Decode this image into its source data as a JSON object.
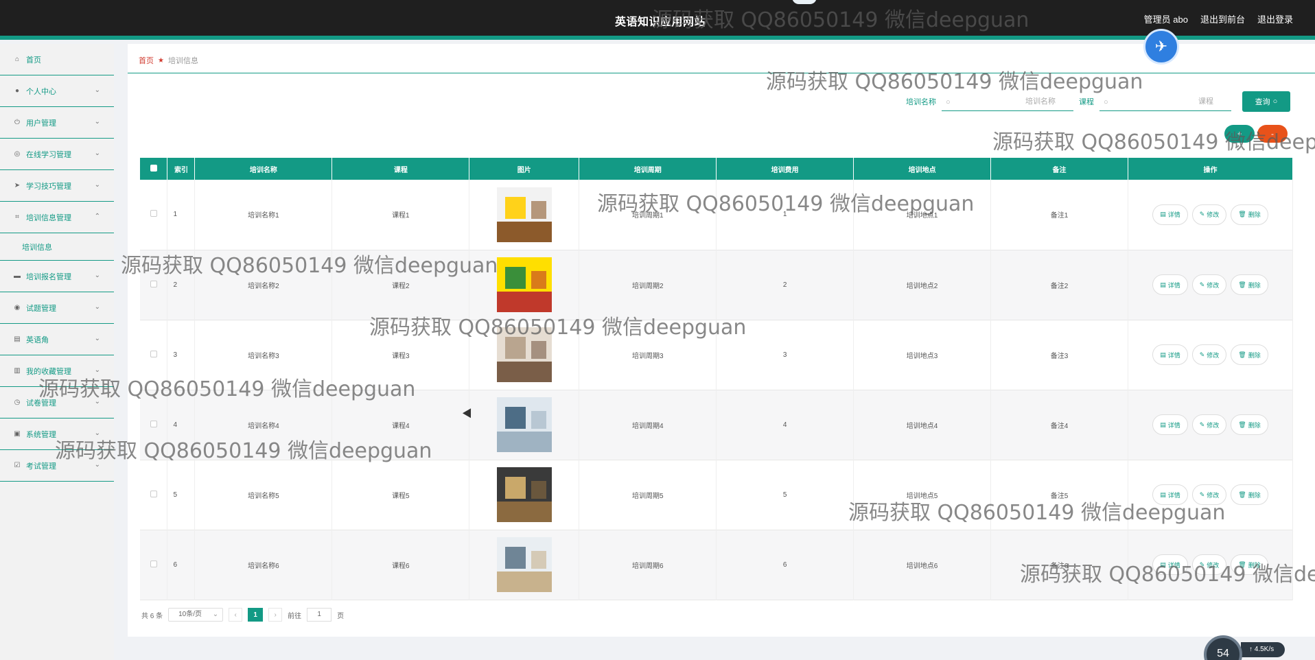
{
  "header": {
    "site_title": "英语知识应用网站",
    "admin_label": "管理员 abo",
    "back_front": "退出到前台",
    "logout": "退出登录"
  },
  "sidebar": {
    "items": [
      {
        "label": "首页",
        "icon": "home-icon"
      },
      {
        "label": "个人中心",
        "icon": "user-icon"
      },
      {
        "label": "用户管理",
        "icon": "power-icon"
      },
      {
        "label": "在线学习管理",
        "icon": "compass-icon"
      },
      {
        "label": "学习技巧管理",
        "icon": "send-icon"
      },
      {
        "label": "培训信息管理",
        "icon": "crop-icon",
        "sub": "培训信息"
      },
      {
        "label": "培训报名管理",
        "icon": "chat-icon"
      },
      {
        "label": "试题管理",
        "icon": "target-icon"
      },
      {
        "label": "英语角",
        "icon": "briefcase-icon"
      },
      {
        "label": "我的收藏管理",
        "icon": "printer-icon"
      },
      {
        "label": "试卷管理",
        "icon": "clock-icon"
      },
      {
        "label": "系统管理",
        "icon": "clipboard-icon"
      },
      {
        "label": "考试管理",
        "icon": "checklist-icon"
      }
    ]
  },
  "breadcrumb": {
    "home": "首页",
    "current": "培训信息"
  },
  "search": {
    "name_label": "培训名称",
    "name_placeholder": "培训名称",
    "course_label": "课程",
    "course_placeholder": "课程",
    "query_label": "查询"
  },
  "actions": {
    "add": "+",
    "delete": "-"
  },
  "table": {
    "headers": [
      "索引",
      "培训名称",
      "课程",
      "图片",
      "培训周期",
      "培训费用",
      "培训地点",
      "备注",
      "操作"
    ],
    "rows": [
      {
        "idx": "1",
        "name": "培训名称1",
        "course": "课程1",
        "period": "培训周期1",
        "fee": "1",
        "place": "培训地点1",
        "note": "备注1"
      },
      {
        "idx": "2",
        "name": "培训名称2",
        "course": "课程2",
        "period": "培训周期2",
        "fee": "2",
        "place": "培训地点2",
        "note": "备注2"
      },
      {
        "idx": "3",
        "name": "培训名称3",
        "course": "课程3",
        "period": "培训周期3",
        "fee": "3",
        "place": "培训地点3",
        "note": "备注3"
      },
      {
        "idx": "4",
        "name": "培训名称4",
        "course": "课程4",
        "period": "培训周期4",
        "fee": "4",
        "place": "培训地点4",
        "note": "备注4"
      },
      {
        "idx": "5",
        "name": "培训名称5",
        "course": "课程5",
        "period": "培训周期5",
        "fee": "5",
        "place": "培训地点5",
        "note": "备注5"
      },
      {
        "idx": "6",
        "name": "培训名称6",
        "course": "课程6",
        "period": "培训周期6",
        "fee": "6",
        "place": "培训地点6",
        "note": "备注6"
      }
    ],
    "op_detail": "详情",
    "op_edit": "修改",
    "op_delete": "删除"
  },
  "pager": {
    "total": "共 6 条",
    "page_size": "10条/页",
    "current": "1",
    "goto_label": "前往",
    "goto_value": "1",
    "page_unit": "页"
  },
  "watermark": "源码获取 QQ86050149 微信deepguan",
  "speed": {
    "percent": "54",
    "rate": "4.5K/s"
  },
  "colors": {
    "accent": "#139a85",
    "danger": "#e8521a",
    "topbar": "#1f1f1f"
  }
}
